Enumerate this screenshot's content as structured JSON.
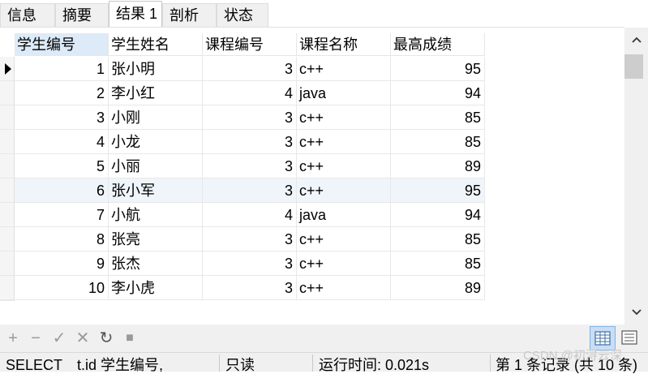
{
  "tabs": [
    {
      "label": "信息"
    },
    {
      "label": "摘要"
    },
    {
      "label": "结果 1"
    },
    {
      "label": "剖析"
    },
    {
      "label": "状态"
    }
  ],
  "grid": {
    "columns": [
      "学生编号",
      "学生姓名",
      "课程编号",
      "课程名称",
      "最高成绩"
    ],
    "rows": [
      [
        "1",
        "张小明",
        "3",
        "c++",
        "95"
      ],
      [
        "2",
        "李小红",
        "4",
        "java",
        "94"
      ],
      [
        "3",
        "小刚",
        "3",
        "c++",
        "85"
      ],
      [
        "4",
        "小龙",
        "3",
        "c++",
        "85"
      ],
      [
        "5",
        "小丽",
        "3",
        "c++",
        "89"
      ],
      [
        "6",
        "张小军",
        "3",
        "c++",
        "95"
      ],
      [
        "7",
        "小航",
        "4",
        "java",
        "94"
      ],
      [
        "8",
        "张亮",
        "3",
        "c++",
        "85"
      ],
      [
        "9",
        "张杰",
        "3",
        "c++",
        "85"
      ],
      [
        "10",
        "李小虎",
        "3",
        "c++",
        "89"
      ]
    ]
  },
  "scrollbar": {
    "up": "⌃",
    "down": "⌄"
  },
  "toolbar": {
    "add": "+",
    "remove": "−",
    "apply": "✓",
    "discard": "✕",
    "refresh": "↻",
    "stop": "■"
  },
  "statusbar": {
    "query": "SELECT",
    "query_detail": "t.id 学生编号,",
    "mode": "只读",
    "runtime": "运行时间: 0.021s",
    "record": "第 1 条记录 (共 10 条)"
  },
  "watermark": "CSDN @初浔云深"
}
